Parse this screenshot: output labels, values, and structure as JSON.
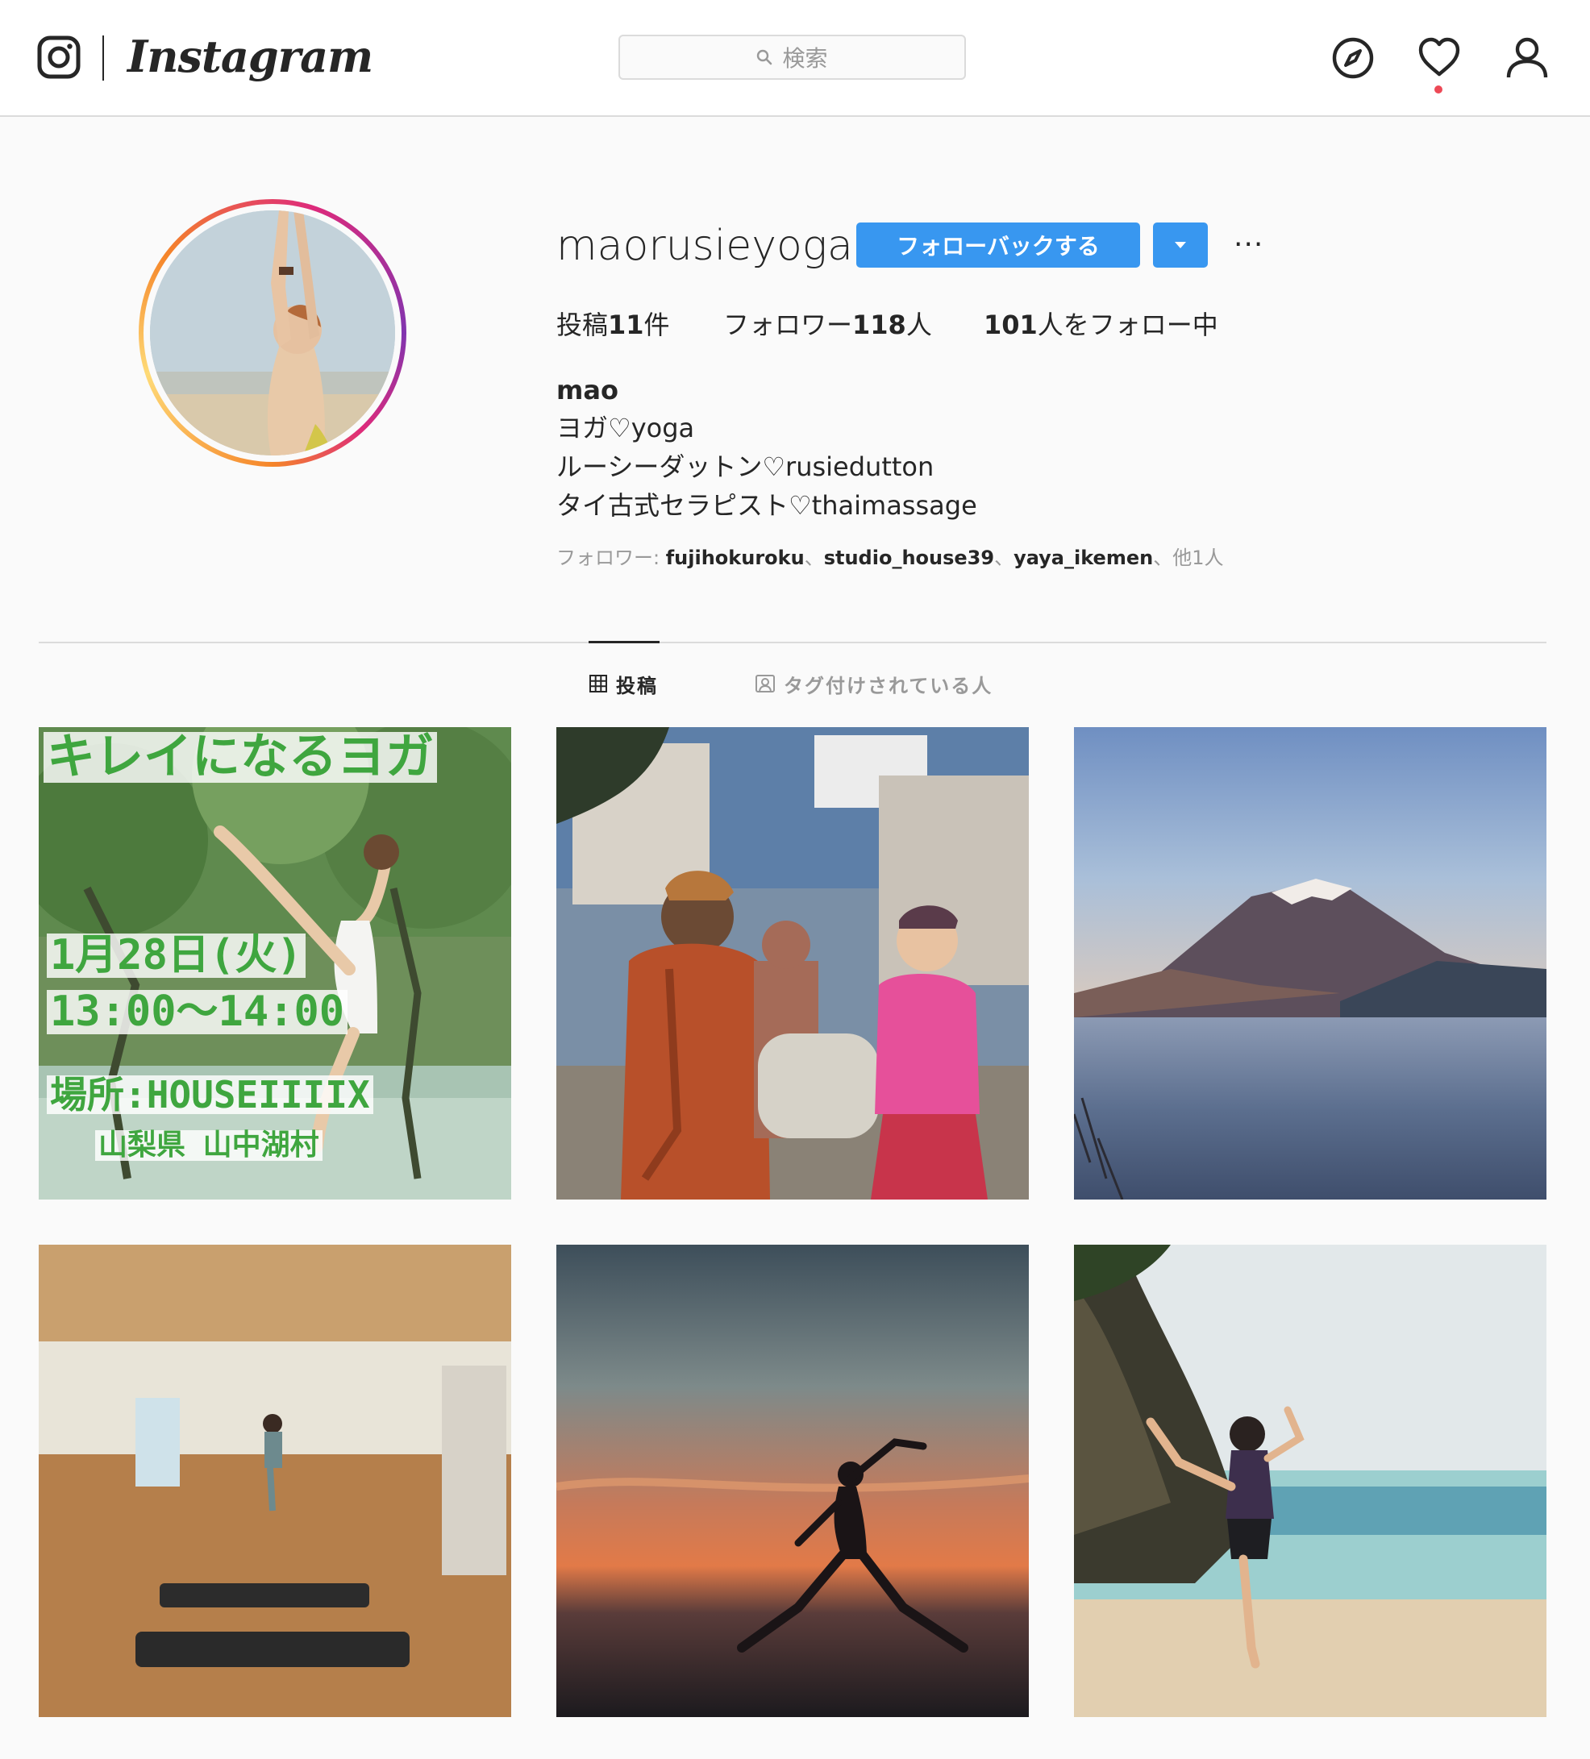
{
  "nav": {
    "brand": "Instagram",
    "search_placeholder": "検索",
    "icons": [
      "instagram-glyph-icon",
      "search-icon",
      "compass-icon",
      "heart-icon",
      "user-icon"
    ],
    "notification_dot_color": "#ed4956"
  },
  "profile": {
    "username": "maorusieyoga",
    "follow_back_label": "フォローバックする",
    "more_label": "···",
    "stats": {
      "posts_prefix": "投稿",
      "posts_count": "11",
      "posts_suffix": "件",
      "followers_prefix": "フォロワー",
      "followers_count": "118",
      "followers_suffix": "人",
      "following_count": "101",
      "following_suffix": "人をフォロー中"
    },
    "name": "mao",
    "bio_lines": [
      "ヨガ♡yoga",
      "ルーシーダットン♡rusiedutton",
      "タイ古式セラピスト♡thaimassage"
    ],
    "followed_by": {
      "label": "フォロワー: ",
      "names": [
        "fujihokuroku",
        "studio_house39",
        "yaya_ikemen"
      ],
      "separator": "、",
      "others": "他1人"
    }
  },
  "tabs": [
    {
      "label": "投稿",
      "active": true,
      "icon": "grid-icon"
    },
    {
      "label": "タグ付けされている人",
      "active": false,
      "icon": "tagged-person-icon"
    }
  ],
  "posts": [
    {
      "poster_lines": [
        "キレイになるヨガ",
        "1月28日(火)",
        "13:00〜14:00",
        "場所:HOUSEIIIIX",
        "山梨県 山中湖村"
      ]
    },
    {
      "id_hint": "india-street"
    },
    {
      "id_hint": "mount-fuji-lake"
    },
    {
      "id_hint": "yoga-studio"
    },
    {
      "id_hint": "beach-sunset-pose"
    },
    {
      "id_hint": "beach-standing-split"
    }
  ],
  "colors": {
    "accent_blue": "#3897f0",
    "text": "#262626",
    "muted": "#999999",
    "border": "#dbdbdb",
    "poster_green": "#3fa63f"
  }
}
